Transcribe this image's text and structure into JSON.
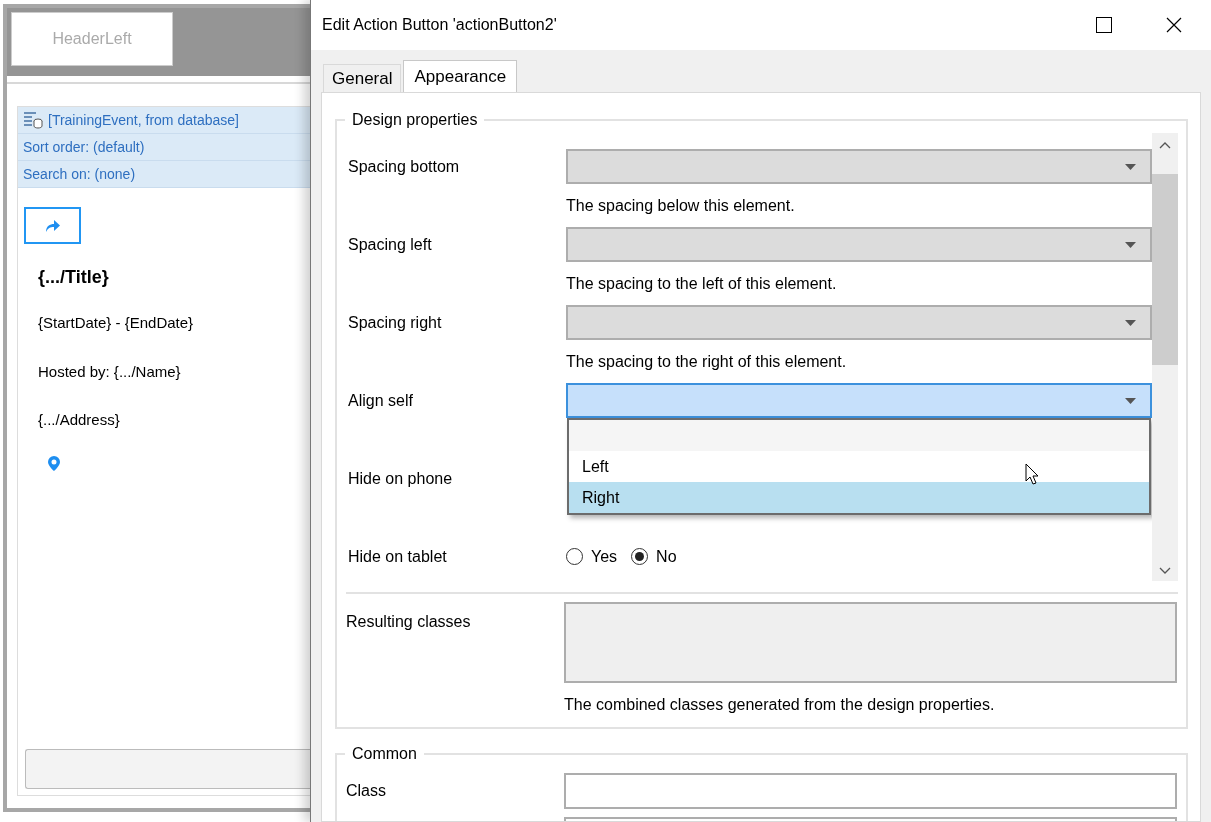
{
  "canvas": {
    "header_left": "HeaderLeft",
    "data_source": "[TrainingEvent, from database]",
    "sort_order": "Sort order: (default)",
    "search_on": "Search on: (none)",
    "title": "{.../Title}",
    "dates": "{StartDate} - {EndDate}",
    "host": "Hosted by: {.../Name}",
    "address": "{.../Address}"
  },
  "dialog": {
    "title": "Edit Action Button 'actionButton2'",
    "tabs": [
      {
        "label": "General",
        "selected": false
      },
      {
        "label": "Appearance",
        "selected": true
      }
    ],
    "design_properties": {
      "legend": "Design properties",
      "rows": [
        {
          "kind": "dropdown",
          "label": "Spacing bottom",
          "description": "The spacing below this element.",
          "focused": false
        },
        {
          "kind": "dropdown",
          "label": "Spacing left",
          "description": "The spacing to the left of this element.",
          "focused": false
        },
        {
          "kind": "dropdown",
          "label": "Spacing right",
          "description": "The spacing to the right of this element.",
          "focused": false
        },
        {
          "kind": "dropdown",
          "label": "Align self",
          "focused": true,
          "expanded": true,
          "options": [
            {
              "label": "Left",
              "selected": false
            },
            {
              "label": "Right",
              "selected": true
            }
          ]
        },
        {
          "kind": "radio",
          "label": "Hide on phone"
        },
        {
          "kind": "radio",
          "label": "Hide on tablet",
          "options": [
            {
              "label": "Yes",
              "selected": false
            },
            {
              "label": "No",
              "selected": true
            }
          ]
        }
      ]
    },
    "resulting_classes": {
      "label": "Resulting classes",
      "description": "The combined classes generated from the design properties."
    },
    "common": {
      "legend": "Common",
      "fields": [
        {
          "label": "Class"
        }
      ]
    }
  }
}
